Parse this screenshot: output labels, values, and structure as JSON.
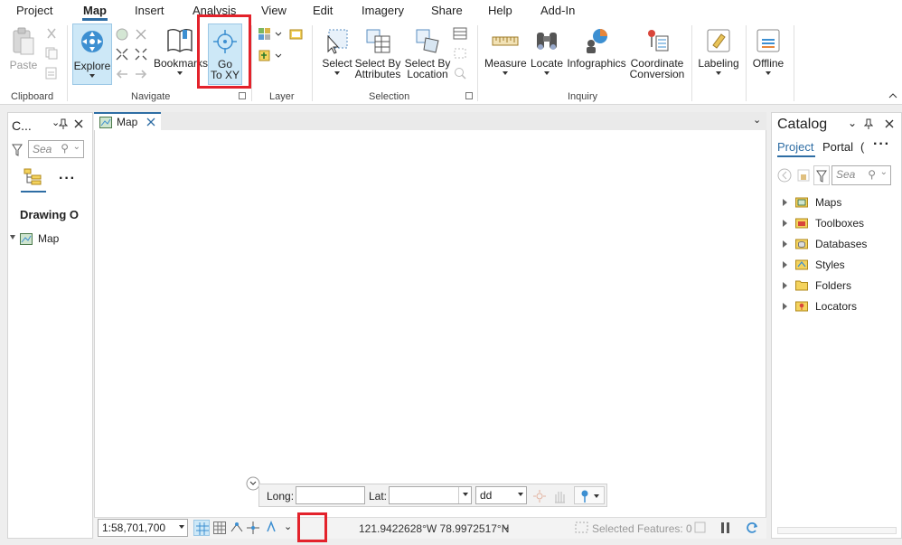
{
  "menu_tabs": [
    "Project",
    "Map",
    "Insert",
    "Analysis",
    "View",
    "Edit",
    "Imagery",
    "Share",
    "Help",
    "Add-In"
  ],
  "active_tab": "Map",
  "ribbon": {
    "clipboard": {
      "paste_label": "Paste",
      "group_label": "Clipboard"
    },
    "navigate": {
      "explore_label": "Explore",
      "bookmarks_label": "Bookmarks",
      "goto_line1": "Go",
      "goto_line2": "To XY",
      "group_label": "Navigate"
    },
    "layer": {
      "group_label": "Layer"
    },
    "selection": {
      "select_label": "Select",
      "select_by_attr_line1": "Select By",
      "select_by_attr_line2": "Attributes",
      "select_by_loc_line1": "Select By",
      "select_by_loc_line2": "Location",
      "group_label": "Selection"
    },
    "inquiry": {
      "measure_label": "Measure",
      "locate_label": "Locate",
      "infographics_label": "Infographics",
      "coord_line1": "Coordinate",
      "coord_line2": "Conversion",
      "group_label": "Inquiry"
    },
    "labeling_label": "Labeling",
    "offline_label": "Offline"
  },
  "left_pane": {
    "title": "C...",
    "search_placeholder": "Sea",
    "drawing_order": "Drawing O",
    "map_item": "Map"
  },
  "map_view": {
    "tab_label": "Map"
  },
  "goto_xy_bar": {
    "long_label": "Long:",
    "long_value": "",
    "lat_label": "Lat:",
    "lat_value": "",
    "format_value": "dd"
  },
  "status_bar": {
    "scale": "1:58,701,700",
    "coordinates": "121.9422628°W 78.9972517°N",
    "selected_features": "Selected Features: 0"
  },
  "catalog": {
    "title": "Catalog",
    "tab_project": "Project",
    "tab_portal": "Portal",
    "tab_more": "(",
    "search_placeholder": "Sea",
    "items": [
      "Maps",
      "Toolboxes",
      "Databases",
      "Styles",
      "Folders",
      "Locators"
    ]
  },
  "colors": {
    "accent": "#2e6da4",
    "highlight": "#e3222b",
    "selected_btn": "#cde8f7"
  }
}
